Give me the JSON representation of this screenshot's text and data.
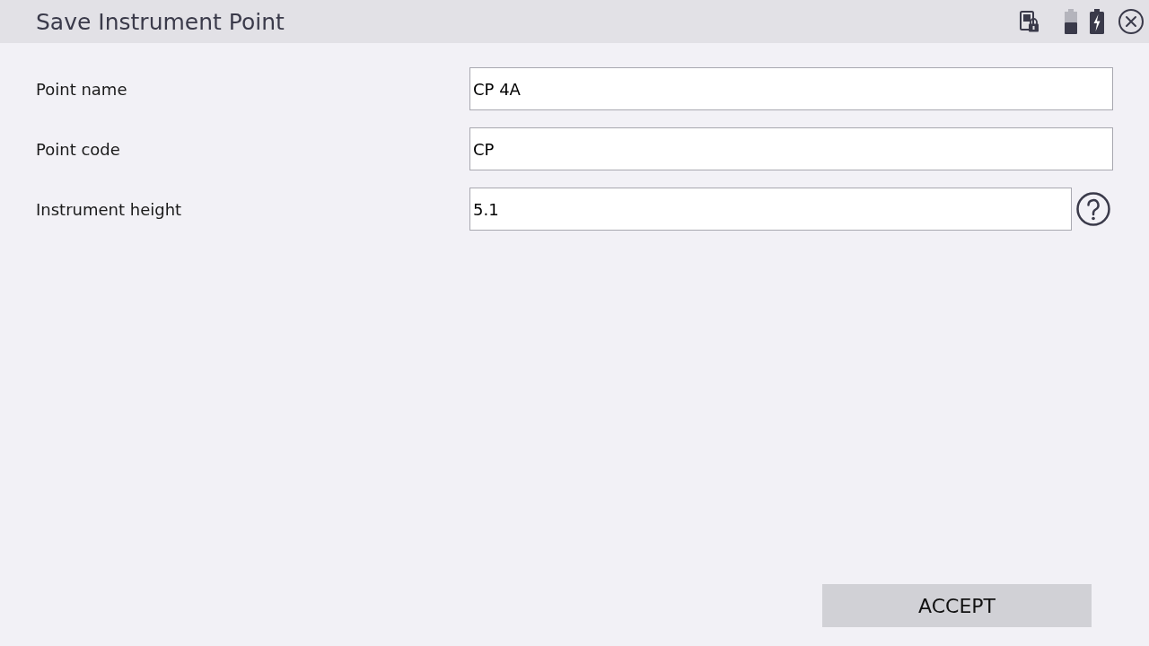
{
  "window": {
    "title": "Save Instrument Point"
  },
  "fields": [
    {
      "label": "Point name",
      "value": "CP 4A",
      "help": false
    },
    {
      "label": "Point code",
      "value": "CP",
      "help": false
    },
    {
      "label": "Instrument height",
      "value": "5.1",
      "help": true
    }
  ],
  "accept_button": {
    "label": "ACCEPT"
  }
}
